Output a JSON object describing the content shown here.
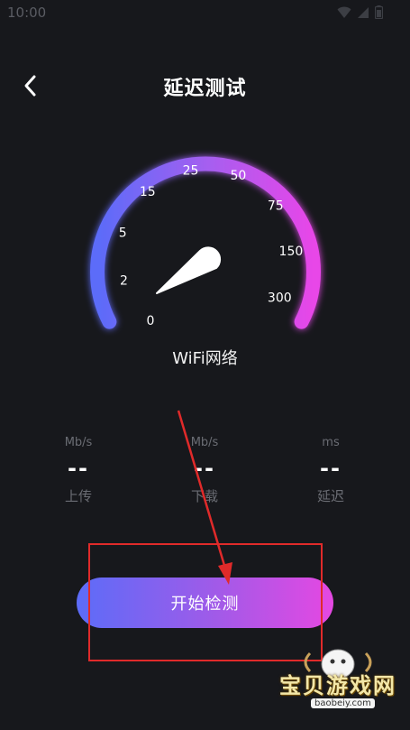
{
  "status_bar": {
    "time": "10:00"
  },
  "header": {
    "title": "延迟测试"
  },
  "gauge": {
    "ticks": [
      "0",
      "2",
      "5",
      "15",
      "25",
      "50",
      "75",
      "150",
      "300"
    ],
    "needle_value": 0,
    "colors": {
      "start": "#5b6cf9",
      "mid": "#a45ff0",
      "end": "#e846e8"
    }
  },
  "network": {
    "name": "WiFi网络"
  },
  "stats": [
    {
      "unit": "Mb/s",
      "value": "--",
      "label": "上传"
    },
    {
      "unit": "Mb/s",
      "value": "--",
      "label": "下载"
    },
    {
      "unit": "ms",
      "value": "--",
      "label": "延迟"
    }
  ],
  "action": {
    "start_label": "开始检测"
  },
  "watermark": {
    "title": "宝贝游戏网",
    "url": "baobeiy.com"
  }
}
